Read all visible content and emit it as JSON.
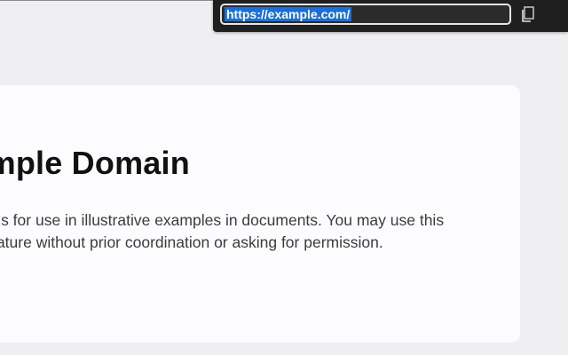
{
  "url_bar": {
    "url": "https://example.com/",
    "copy_icon": "copy-icon"
  },
  "card": {
    "heading": "Example Domain",
    "paragraph_line1": "This domain is for use in illustrative examples in documents. You may use this",
    "paragraph_line2": "domain in literature without prior coordination or asking for permission."
  },
  "colors": {
    "page_background": "#efeff1",
    "card_background": "#fcfcfe",
    "popup_background": "#1f1f1f",
    "selection": "#1a6fd8"
  }
}
